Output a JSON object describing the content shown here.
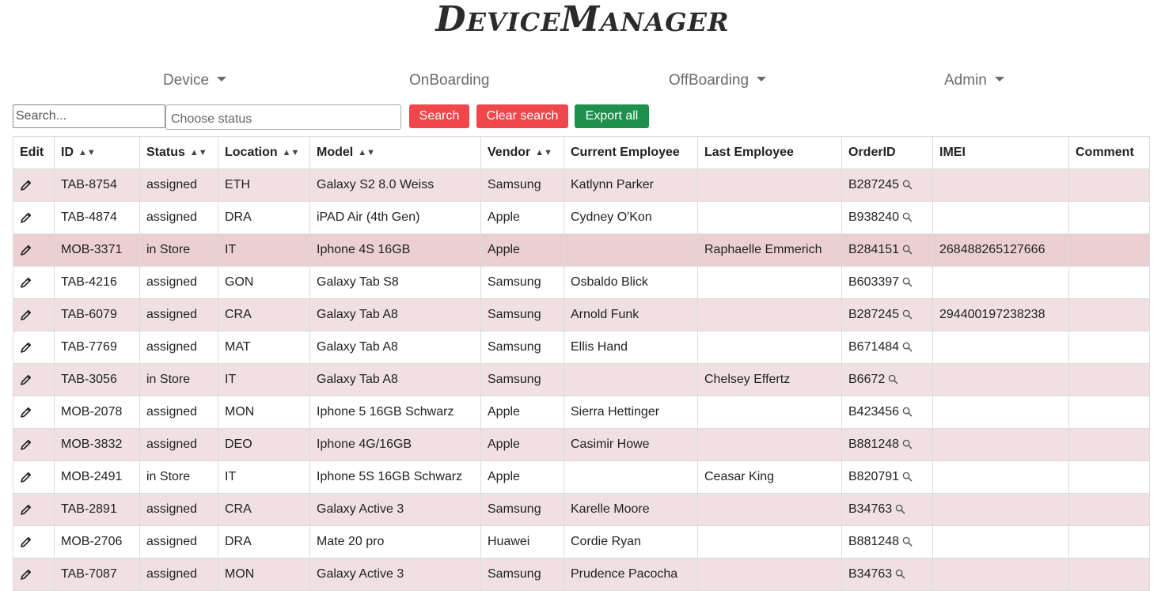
{
  "app": {
    "title_first_initial": "D",
    "title_first_rest": "EVICE",
    "title_second_initial": "M",
    "title_second_rest": "ANAGER"
  },
  "nav": {
    "device": "Device",
    "onboarding": "OnBoarding",
    "offboarding": "OffBoarding",
    "admin": "Admin"
  },
  "toolbar": {
    "search_placeholder": "Search...",
    "status_placeholder": "Choose status",
    "search_label": "Search",
    "clear_label": "Clear search",
    "export_label": "Export all"
  },
  "table": {
    "headers": {
      "edit": "Edit",
      "id": "ID",
      "status": "Status",
      "location": "Location",
      "model": "Model",
      "vendor": "Vendor",
      "current_employee": "Current Employee",
      "last_employee": "Last Employee",
      "order_id": "OrderID",
      "imei": "IMEI",
      "comment": "Comment"
    },
    "rows": [
      {
        "id": "TAB-8754",
        "status": "assigned",
        "location": "ETH",
        "model": "Galaxy S2 8.0 Weiss",
        "vendor": "Samsung",
        "current_employee": "Katlynn Parker",
        "last_employee": "",
        "order_id": "B287245",
        "imei": "",
        "comment": ""
      },
      {
        "id": "TAB-4874",
        "status": "assigned",
        "location": "DRA",
        "model": "iPAD Air (4th Gen)",
        "vendor": "Apple",
        "current_employee": "Cydney O'Kon",
        "last_employee": "",
        "order_id": "B938240",
        "imei": "",
        "comment": ""
      },
      {
        "id": "MOB-3371",
        "status": "in Store",
        "location": "IT",
        "model": "Iphone 4S 16GB",
        "vendor": "Apple",
        "current_employee": "",
        "last_employee": "Raphaelle Emmerich",
        "order_id": "B284151",
        "imei": "268488265127666",
        "comment": ""
      },
      {
        "id": "TAB-4216",
        "status": "assigned",
        "location": "GON",
        "model": "Galaxy Tab S8",
        "vendor": "Samsung",
        "current_employee": "Osbaldo Blick",
        "last_employee": "",
        "order_id": "B603397",
        "imei": "",
        "comment": ""
      },
      {
        "id": "TAB-6079",
        "status": "assigned",
        "location": "CRA",
        "model": "Galaxy Tab A8",
        "vendor": "Samsung",
        "current_employee": "Arnold Funk",
        "last_employee": "",
        "order_id": "B287245",
        "imei": "294400197238238",
        "comment": ""
      },
      {
        "id": "TAB-7769",
        "status": "assigned",
        "location": "MAT",
        "model": "Galaxy Tab A8",
        "vendor": "Samsung",
        "current_employee": "Ellis Hand",
        "last_employee": "",
        "order_id": "B671484",
        "imei": "",
        "comment": ""
      },
      {
        "id": "TAB-3056",
        "status": "in Store",
        "location": "IT",
        "model": "Galaxy Tab A8",
        "vendor": "Samsung",
        "current_employee": "",
        "last_employee": "Chelsey Effertz",
        "order_id": "B6672",
        "imei": "",
        "comment": ""
      },
      {
        "id": "MOB-2078",
        "status": "assigned",
        "location": "MON",
        "model": "Iphone 5 16GB Schwarz",
        "vendor": "Apple",
        "current_employee": "Sierra Hettinger",
        "last_employee": "",
        "order_id": "B423456",
        "imei": "",
        "comment": ""
      },
      {
        "id": "MOB-3832",
        "status": "assigned",
        "location": "DEO",
        "model": "Iphone 4G/16GB",
        "vendor": "Apple",
        "current_employee": "Casimir Howe",
        "last_employee": "",
        "order_id": "B881248",
        "imei": "",
        "comment": ""
      },
      {
        "id": "MOB-2491",
        "status": "in Store",
        "location": "IT",
        "model": "Iphone 5S 16GB Schwarz",
        "vendor": "Apple",
        "current_employee": "",
        "last_employee": "Ceasar King",
        "order_id": "B820791",
        "imei": "",
        "comment": ""
      },
      {
        "id": "TAB-2891",
        "status": "assigned",
        "location": "CRA",
        "model": "Galaxy Active 3",
        "vendor": "Samsung",
        "current_employee": "Karelle Moore",
        "last_employee": "",
        "order_id": "B34763",
        "imei": "",
        "comment": ""
      },
      {
        "id": "MOB-2706",
        "status": "assigned",
        "location": "DRA",
        "model": "Mate 20 pro",
        "vendor": "Huawei",
        "current_employee": "Cordie Ryan",
        "last_employee": "",
        "order_id": "B881248",
        "imei": "",
        "comment": ""
      },
      {
        "id": "TAB-7087",
        "status": "assigned",
        "location": "MON",
        "model": "Galaxy Active 3",
        "vendor": "Samsung",
        "current_employee": "Prudence Pacocha",
        "last_employee": "",
        "order_id": "B34763",
        "imei": "",
        "comment": ""
      }
    ]
  },
  "icons": {
    "edit": "pencil-icon",
    "order_lookup": "magnifier-icon",
    "sort": "sort-arrows-icon",
    "dropdown": "caret-down-icon"
  },
  "colors": {
    "danger": "#f0474b",
    "success": "#1f8f4e",
    "row_stripe": "#f0e0e1",
    "row_highlight": "#ecd0d1"
  }
}
